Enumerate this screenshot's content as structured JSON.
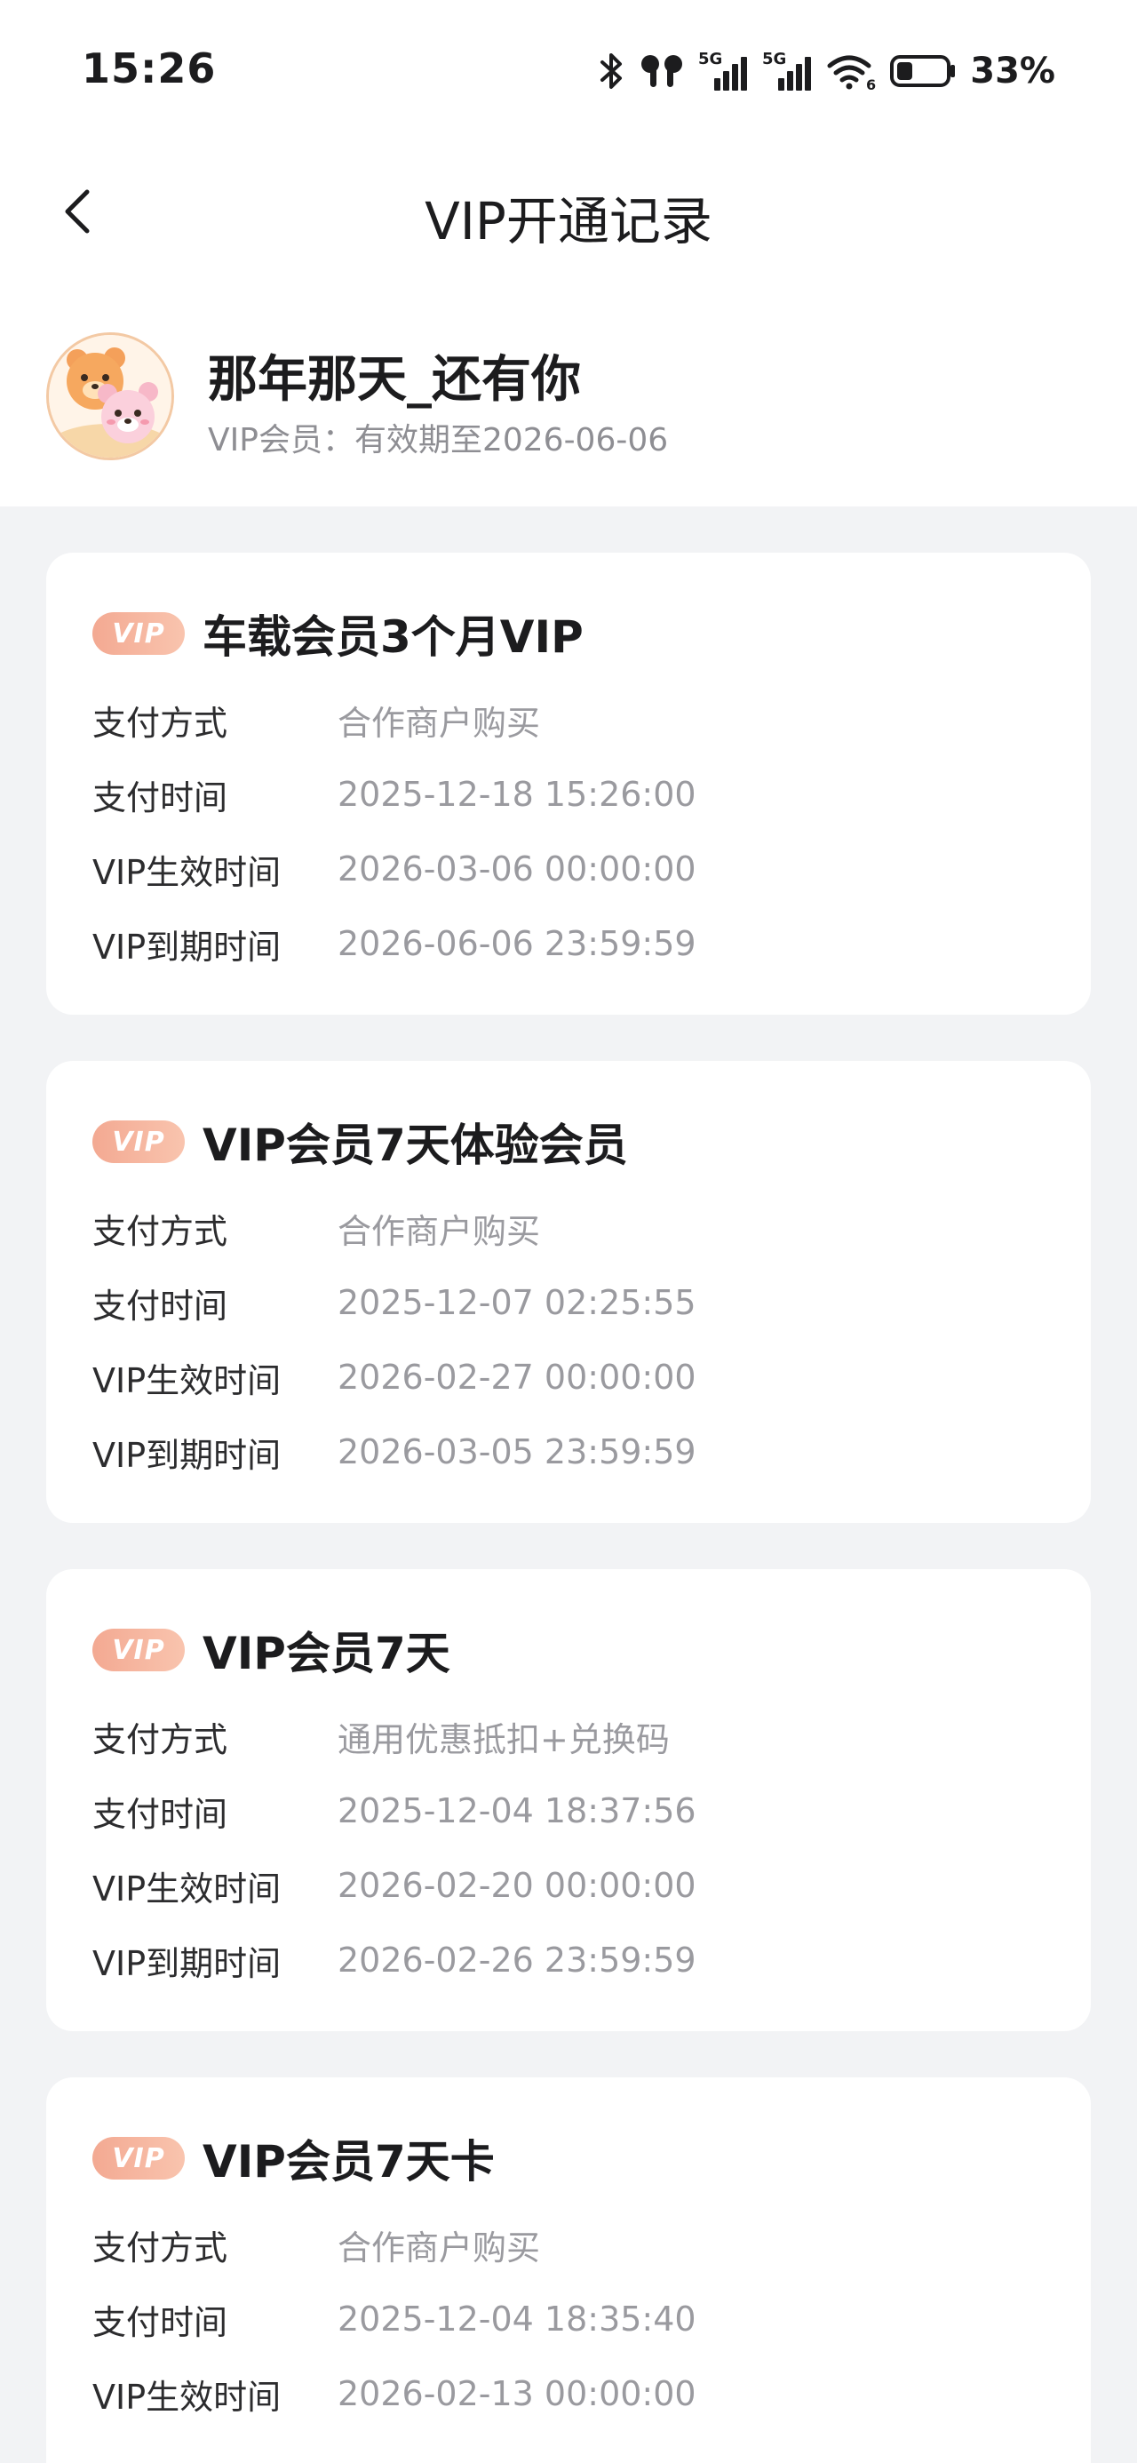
{
  "status_bar": {
    "time": "15:26",
    "battery_percent": "33%",
    "network_label_1": "5G",
    "network_label_2": "5G",
    "wifi_label": "6",
    "battery_level": 0.33
  },
  "header": {
    "title": "VIP开通记录"
  },
  "profile": {
    "username": "那年那天_还有你",
    "vip_status": "VIP会员：有效期至2026-06-06"
  },
  "badge_label": "VIP",
  "records": [
    {
      "title": "车载会员3个月VIP",
      "rows": [
        {
          "label": "支付方式",
          "value": "合作商户购买"
        },
        {
          "label": "支付时间",
          "value": "2025-12-18 15:26:00"
        },
        {
          "label": "VIP生效时间",
          "value": "2026-03-06 00:00:00"
        },
        {
          "label": "VIP到期时间",
          "value": "2026-06-06 23:59:59"
        }
      ]
    },
    {
      "title": "VIP会员7天体验会员",
      "rows": [
        {
          "label": "支付方式",
          "value": "合作商户购买"
        },
        {
          "label": "支付时间",
          "value": "2025-12-07 02:25:55"
        },
        {
          "label": "VIP生效时间",
          "value": "2026-02-27 00:00:00"
        },
        {
          "label": "VIP到期时间",
          "value": "2026-03-05 23:59:59"
        }
      ]
    },
    {
      "title": "VIP会员7天",
      "rows": [
        {
          "label": "支付方式",
          "value": "通用优惠抵扣+兑换码"
        },
        {
          "label": "支付时间",
          "value": "2025-12-04 18:37:56"
        },
        {
          "label": "VIP生效时间",
          "value": "2026-02-20 00:00:00"
        },
        {
          "label": "VIP到期时间",
          "value": "2026-02-26 23:59:59"
        }
      ]
    },
    {
      "title": "VIP会员7天卡",
      "rows": [
        {
          "label": "支付方式",
          "value": "合作商户购买"
        },
        {
          "label": "支付时间",
          "value": "2025-12-04 18:35:40"
        },
        {
          "label": "VIP生效时间",
          "value": "2026-02-13 00:00:00"
        }
      ]
    }
  ],
  "colors": {
    "badge_start": "#f3a992",
    "badge_end": "#f9c4ae",
    "page_background": "#f2f3f5",
    "value_text": "#9a9a9f"
  }
}
